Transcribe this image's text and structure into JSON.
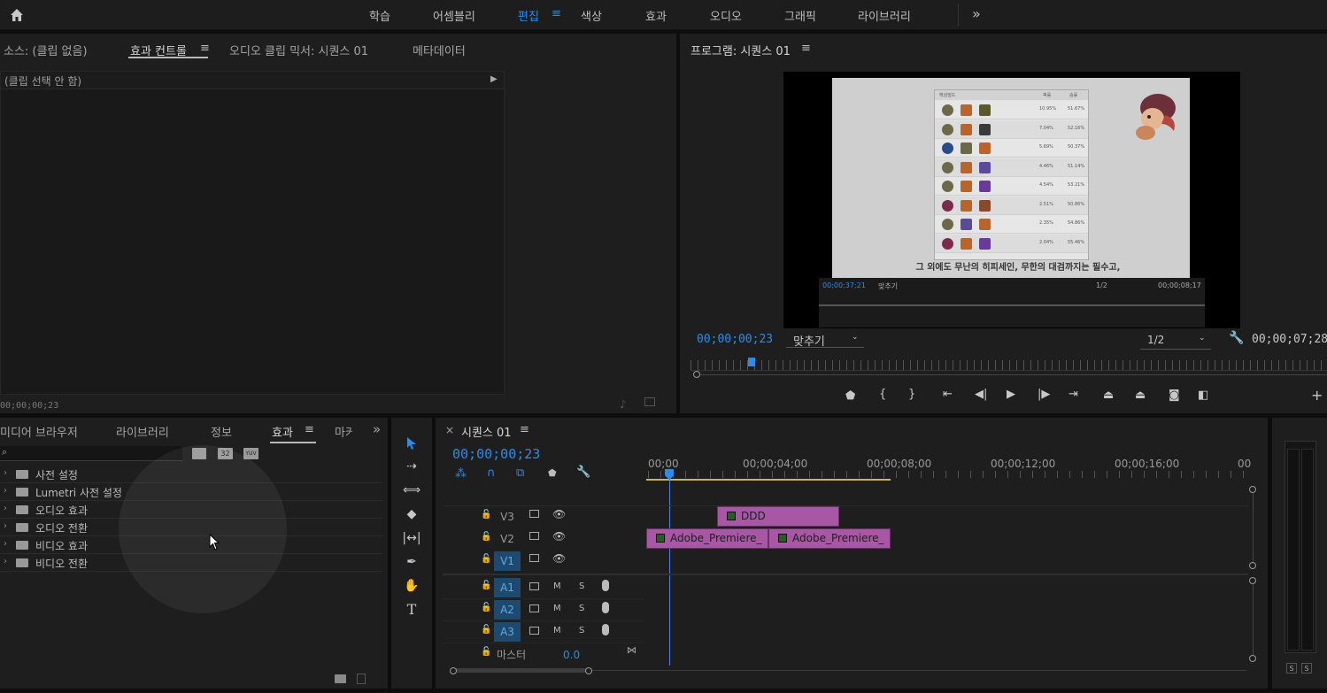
{
  "workspace_tabs": [
    {
      "label": "학습",
      "active": false
    },
    {
      "label": "어셈블리",
      "active": false
    },
    {
      "label": "편집",
      "active": true
    },
    {
      "label": "색상",
      "active": false
    },
    {
      "label": "효과",
      "active": false
    },
    {
      "label": "오디오",
      "active": false
    },
    {
      "label": "그래픽",
      "active": false
    },
    {
      "label": "라이브러리",
      "active": false
    }
  ],
  "workspace_menu_glyph": "≡",
  "workspace_overflow": "»",
  "source_panel": {
    "tabs": [
      "소스: (클립 없음)",
      "효과 컨트롤",
      "오디오 클립 믹서: 시퀀스 01",
      "메타데이터"
    ],
    "active_tab_index": 1,
    "no_clip_text": "(클립 선택 안 함)",
    "timecode": "00;00;00;23"
  },
  "program_panel": {
    "title": "프로그램: 시퀀스 01",
    "current_timecode": "00;00;00;23",
    "fit_select": "맞추기",
    "resolution_select": "1/2",
    "duration_timecode": "00;00;07;28",
    "preview": {
      "subtitle": "그 외에도 무난의 히피세인, 무한의 대검까지는 필수고,",
      "inner_timecode_left": "00;00;37;21",
      "inner_fit": "맞추기",
      "inner_resolution": "1/2",
      "inner_timecode_right": "00;00;08;17",
      "table_header": [
        "핵심빌드",
        "픽률",
        "승률"
      ],
      "table_rows": [
        [
          "10.95%",
          "51.67%"
        ],
        [
          "7.04%",
          "52.16%"
        ],
        [
          "5.69%",
          "50.37%"
        ],
        [
          "4.46%",
          "51.14%"
        ],
        [
          "4.54%",
          "53.21%"
        ],
        [
          "2.51%",
          "50.86%"
        ],
        [
          "2.35%",
          "54.86%"
        ],
        [
          "2.04%",
          "55.46%"
        ]
      ]
    }
  },
  "project_panel": {
    "tabs": [
      "미디어 브라우저",
      "라이브러리",
      "정보",
      "효과",
      "마커"
    ],
    "active_tab_index": 3,
    "search_placeholder": "",
    "filter_buttons": [
      "",
      "32",
      "YUV"
    ],
    "tree": [
      {
        "label": "사전 설정",
        "special": true
      },
      {
        "label": "Lumetri 사전 설정",
        "special": true
      },
      {
        "label": "오디오 효과",
        "special": false
      },
      {
        "label": "오디오 전환",
        "special": false
      },
      {
        "label": "비디오 효과",
        "special": false
      },
      {
        "label": "비디오 전환",
        "special": false
      }
    ]
  },
  "timeline": {
    "tab_label": "시퀀스 01",
    "close_glyph": "×",
    "timecode": "00;00;00;23",
    "ruler": [
      "00;00",
      "00;00;04;00",
      "00;00;08;00",
      "00;00;12;00",
      "00;00;16;00",
      "00"
    ],
    "video_tracks": [
      {
        "name": "V3",
        "target": false
      },
      {
        "name": "V2",
        "target": false
      },
      {
        "name": "V1",
        "target": true
      }
    ],
    "audio_tracks": [
      {
        "name": "A1",
        "m": "M",
        "s": "S"
      },
      {
        "name": "A2",
        "m": "M",
        "s": "S"
      },
      {
        "name": "A3",
        "m": "M",
        "s": "S"
      }
    ],
    "master_label": "마스터",
    "master_value": "0.0",
    "clips": [
      {
        "label": "DDD",
        "track": "V3"
      },
      {
        "label": "Adobe_Premiere_",
        "track": "V2"
      },
      {
        "label": "Adobe_Premiere_",
        "track": "V2"
      }
    ]
  },
  "audio_meter": {
    "buttons": [
      "S",
      "S"
    ]
  }
}
